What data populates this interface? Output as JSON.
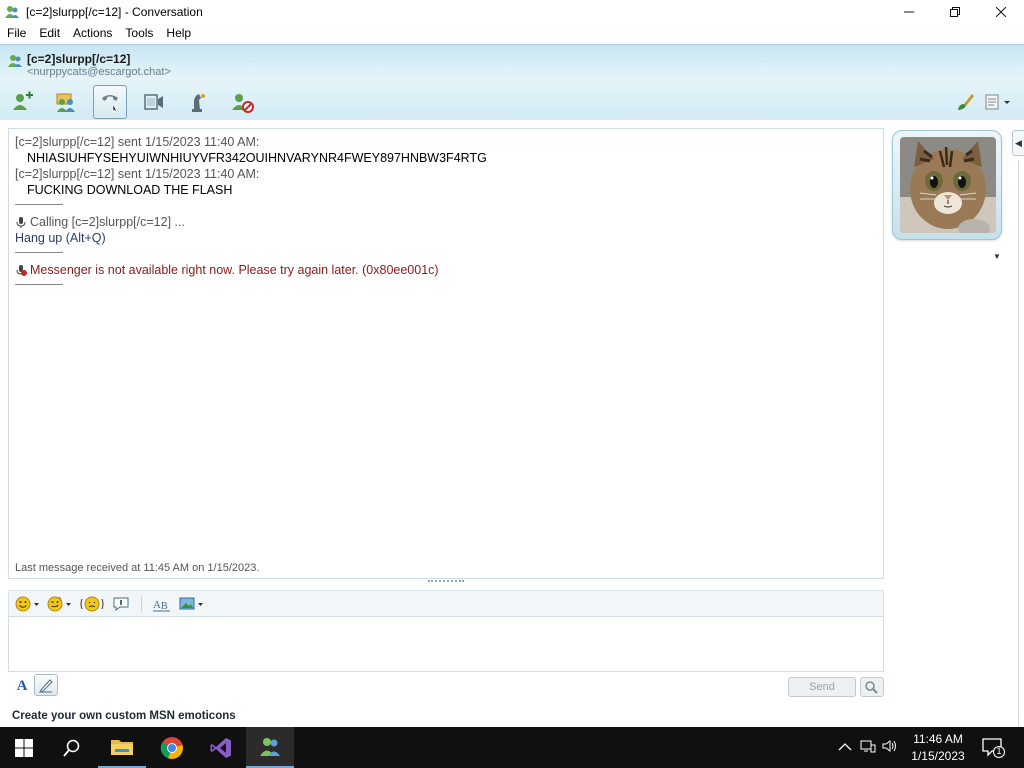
{
  "window": {
    "title": "[c=2]slurpp[/c=12] - Conversation",
    "controls": {
      "minimize": "—",
      "restore": "❐",
      "close": "✕"
    }
  },
  "menu": [
    "File",
    "Edit",
    "Actions",
    "Tools",
    "Help"
  ],
  "contact": {
    "name": "[c=2]slurpp[/c=12]",
    "email": "<nurppycats@escargot.chat>"
  },
  "toolbar": {
    "buttons": [
      "invite-contact-icon",
      "share-files-icon",
      "call-icon",
      "video-icon",
      "games-icon",
      "block-icon"
    ],
    "right_buttons": [
      "paint-brush-icon",
      "display-options-icon"
    ]
  },
  "chat": {
    "messages": [
      {
        "header": "[c=2]slurpp[/c=12] sent 1/15/2023 11:40 AM:",
        "text": "NHIASIUHFYSEHYUIWNHIUYVFR342OUIHNVARYNR4FWEY897HNBW3F4RTG"
      },
      {
        "header": "[c=2]slurpp[/c=12] sent 1/15/2023 11:40 AM:",
        "text": "FUCKING DOWNLOAD THE FLASH"
      }
    ],
    "calling": "Calling [c=2]slurpp[/c=12] ...",
    "hangup": "Hang up (Alt+Q)",
    "error": "Messenger is not available right now. Please try again later. (0x80ee001c)",
    "last_received": "Last message received at 11:45 AM on 1/15/2023."
  },
  "input": {
    "value": "",
    "send_label": "Send"
  },
  "footer": {
    "link": "Create your own custom MSN emoticons"
  },
  "taskbar": {
    "apps": [
      "start",
      "search",
      "file-explorer",
      "chrome",
      "visual-studio",
      "messenger"
    ],
    "time": "11:46 AM",
    "date": "1/15/2023",
    "notification_count": "1"
  },
  "colors": {
    "header_gradient_top": "#c6e6f2",
    "error_text": "#8b1a1a",
    "taskbar": "#101010"
  }
}
